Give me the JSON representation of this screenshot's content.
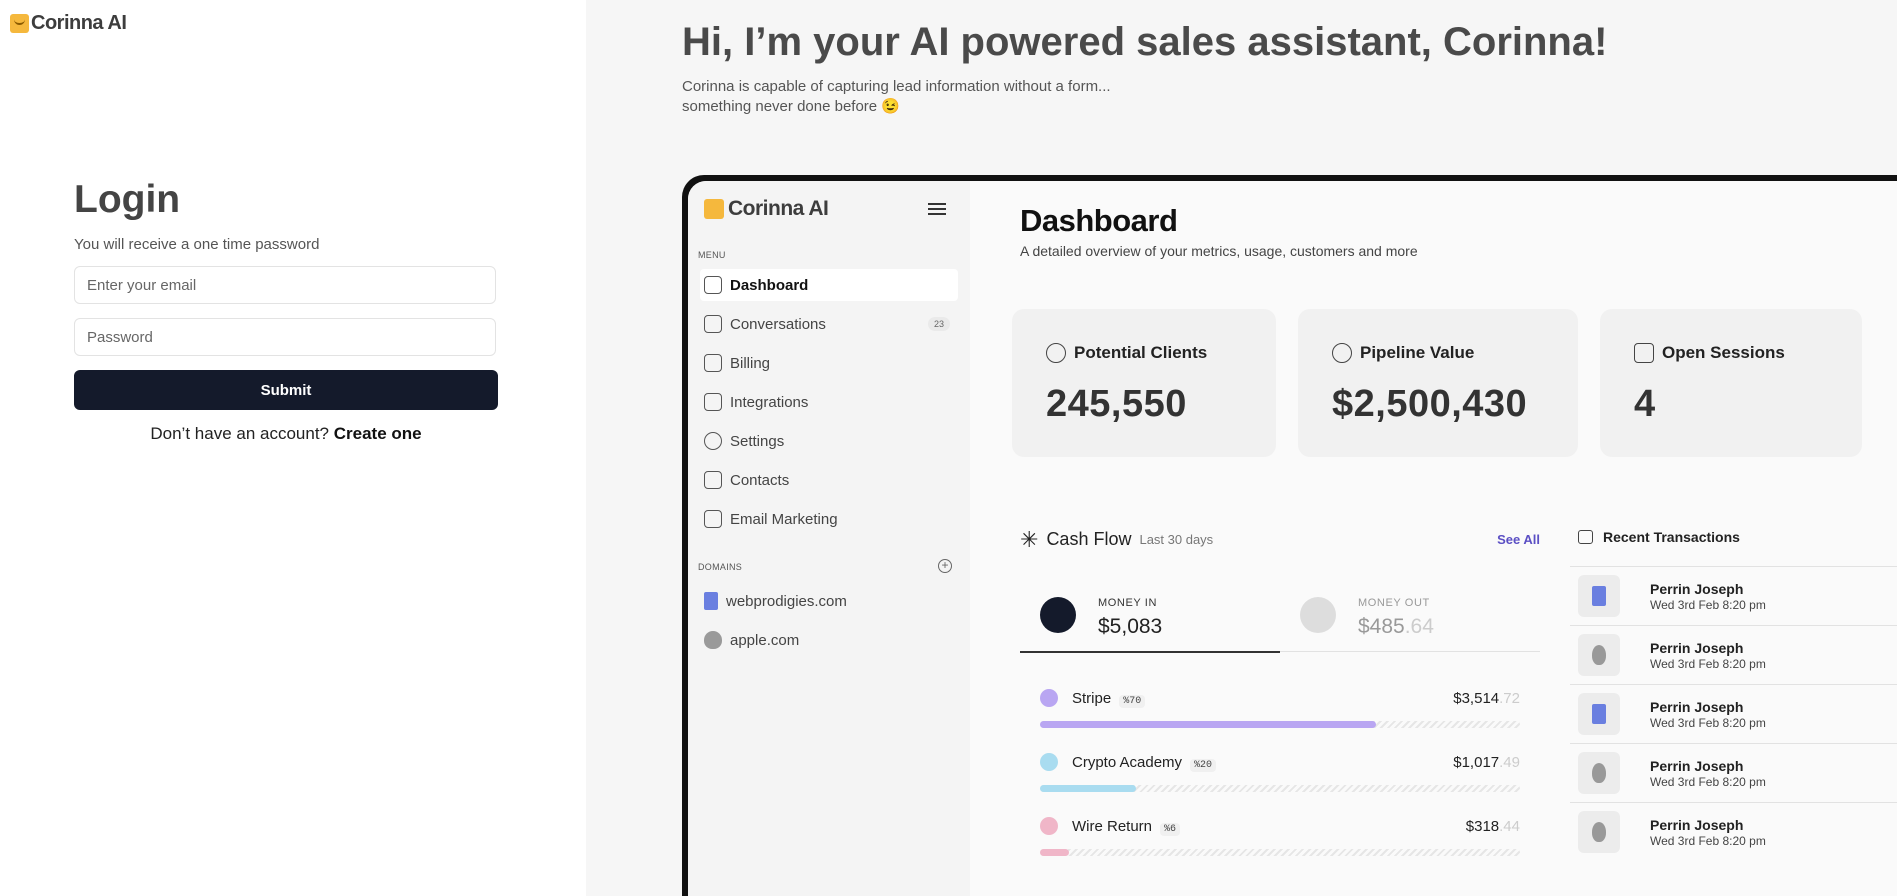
{
  "brand": {
    "name": "Corinna AI"
  },
  "login": {
    "title": "Login",
    "subtitle": "You will receive a one time password",
    "email_placeholder": "Enter your email",
    "password_placeholder": "Password",
    "submit_label": "Submit",
    "signup_prompt": "Don’t have an account?",
    "signup_link": "Create one"
  },
  "hero": {
    "title": "Hi, I’m your AI powered sales assistant, Corinna!",
    "subtitle_line1": "Corinna is capable of capturing lead information without a form...",
    "subtitle_line2": "something never done before 😉"
  },
  "preview": {
    "sidebar": {
      "brand": "Corinna AI",
      "menu_label": "MENU",
      "items": [
        {
          "label": "Dashboard",
          "icon": "grid-icon",
          "active": true
        },
        {
          "label": "Conversations",
          "icon": "chat-icon",
          "badge": "23"
        },
        {
          "label": "Billing",
          "icon": "card-icon"
        },
        {
          "label": "Integrations",
          "icon": "sliders-icon"
        },
        {
          "label": "Settings",
          "icon": "gear-icon"
        },
        {
          "label": "Contacts",
          "icon": "contact-icon"
        },
        {
          "label": "Email Marketing",
          "icon": "mail-icon"
        }
      ],
      "domains_label": "DOMAINS",
      "domains": [
        {
          "label": "webprodigies.com",
          "icon": "book-icon"
        },
        {
          "label": "apple.com",
          "icon": "apple-icon"
        }
      ]
    },
    "dashboard": {
      "title": "Dashboard",
      "subtitle": "A detailed overview of your metrics, usage, customers and more",
      "cards": [
        {
          "label": "Potential Clients",
          "value": "245,550",
          "icon": "user-icon"
        },
        {
          "label": "Pipeline Value",
          "value": "$2,500,430",
          "icon": "dollar-icon"
        },
        {
          "label": "Open Sessions",
          "value": "4",
          "icon": "chat-icon"
        }
      ]
    },
    "cash_flow": {
      "title": "Cash Flow",
      "period": "Last 30 days",
      "see_all": "See All",
      "money_in": {
        "label": "MONEY IN",
        "value": "$5,083"
      },
      "money_out": {
        "label": "MONEY OUT",
        "value": "$485",
        "cents": ".64"
      },
      "sources": [
        {
          "name": "Stripe",
          "pct": "%70",
          "amount": "$3,514",
          "cents": ".72",
          "color": "#b9a6f2",
          "share": 0.7
        },
        {
          "name": "Crypto Academy",
          "pct": "%20",
          "amount": "$1,017",
          "cents": ".49",
          "color": "#a9dcf0",
          "share": 0.2
        },
        {
          "name": "Wire Return",
          "pct": "%6",
          "amount": "$318",
          "cents": ".44",
          "color": "#f0b6c8",
          "share": 0.06
        }
      ]
    },
    "transactions": {
      "title": "Recent Transactions",
      "items": [
        {
          "name": "Perrin Joseph",
          "date": "Wed 3rd Feb 8:20 pm",
          "icon": "book-icon"
        },
        {
          "name": "Perrin Joseph",
          "date": "Wed 3rd Feb 8:20 pm",
          "icon": "apple-icon"
        },
        {
          "name": "Perrin Joseph",
          "date": "Wed 3rd Feb 8:20 pm",
          "icon": "book-icon"
        },
        {
          "name": "Perrin Joseph",
          "date": "Wed 3rd Feb 8:20 pm",
          "icon": "apple-icon"
        },
        {
          "name": "Perrin Joseph",
          "date": "Wed 3rd Feb 8:20 pm",
          "icon": "apple-icon"
        }
      ]
    }
  }
}
